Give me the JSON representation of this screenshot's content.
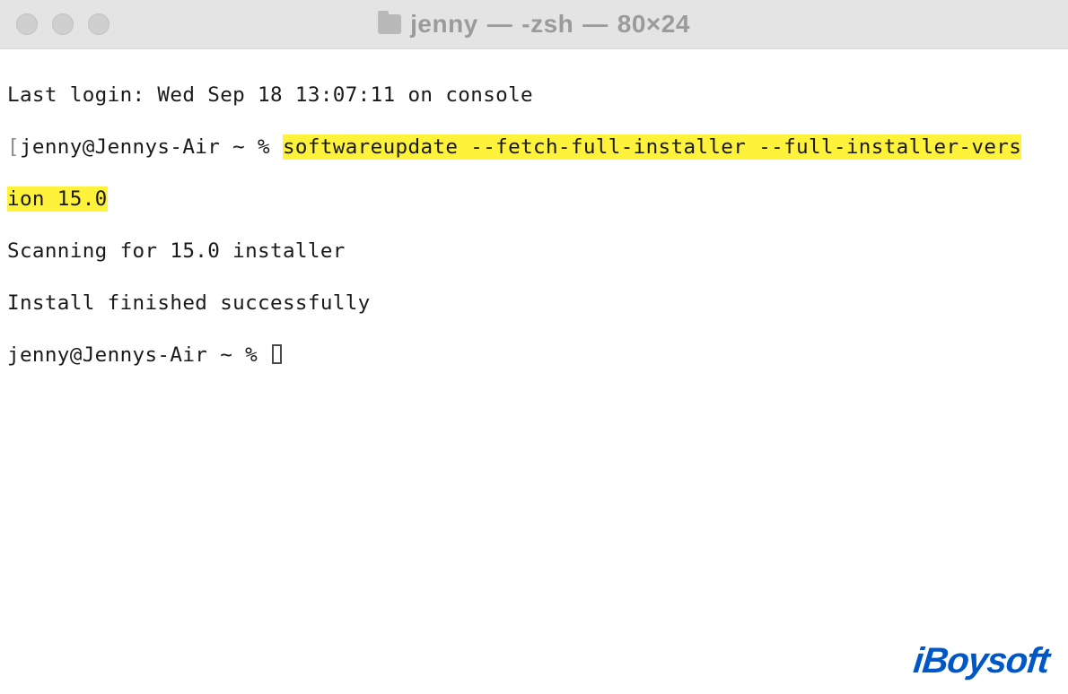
{
  "window": {
    "title_folder": "jenny",
    "title_process": "-zsh",
    "title_size": "80×24"
  },
  "terminal": {
    "last_login": "Last login: Wed Sep 18 13:07:11 on console",
    "prompt1_prefix_open": "[",
    "prompt1_user": "jenny@Jennys-Air ~ % ",
    "command_part1": "softwareupdate --fetch-full-installer --full-installer-vers",
    "command_part2": "ion 15.0",
    "output1": "Scanning for 15.0 installer",
    "output2": "Install finished successfully",
    "prompt2_user": "jenny@Jennys-Air ~ % "
  },
  "watermark": "iBoysoft"
}
